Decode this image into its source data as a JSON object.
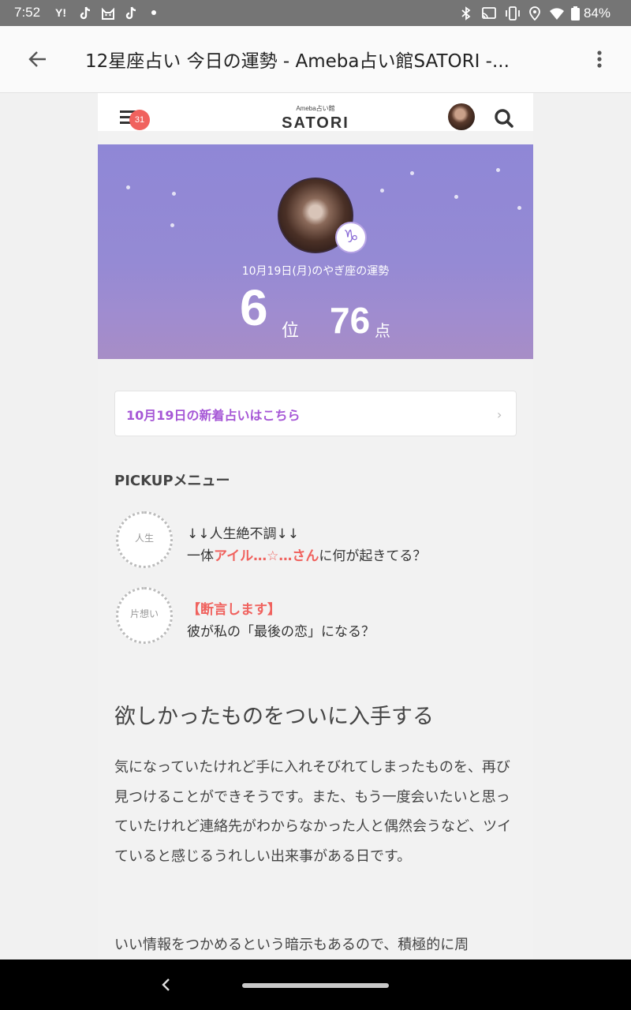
{
  "status_bar": {
    "time": "7:52",
    "notifications": [
      "Y!",
      "tiktok-icon",
      "cat-icon",
      "tiktok-icon",
      "dot"
    ],
    "battery": "84%"
  },
  "app_bar": {
    "title": "12星座占い 今日の運勢 - Ameba占い館SATORI -..."
  },
  "site": {
    "logo_sub": "Ameba占い館",
    "logo_main": "SATORI",
    "menu_badge": "31"
  },
  "hero": {
    "sign_symbol": "♑",
    "date_label": "10月19日(月)のやぎ座の運勢",
    "rank": "6",
    "rank_unit": "位",
    "score": "76",
    "score_unit": "点"
  },
  "new_link": {
    "label": "10月19日の新着占いはこちら",
    "chevron": "›"
  },
  "pickup": {
    "title": "PICKUPメニュー",
    "items": [
      {
        "badge": "人生",
        "line1": "↓↓人生絶不調↓↓",
        "line2_pre": "一体",
        "line2_accent": "アイル…☆…さん",
        "line2_post": "に何が起きてる？"
      },
      {
        "badge": "片想い",
        "line1_accent": "【断言します】",
        "line2": "彼が私の「最後の恋」になる？"
      }
    ]
  },
  "article": {
    "title": "欲しかったものをついに入手する",
    "paragraph1": "気になっていたけれど手に入れそびれてしまったものを、再び見つけることができそうです。また、もう一度会いたいと思っていたけれど連絡先がわからなかった人と偶然会うなど、ツイていると感じるうれしい出来事がある日です。",
    "paragraph2": "いい情報をつかめるという暗示もあるので、積極的に周"
  },
  "colors": {
    "accent": "#f0625e",
    "link_purple": "#a657d6",
    "hero_purple": "#958ad4"
  }
}
